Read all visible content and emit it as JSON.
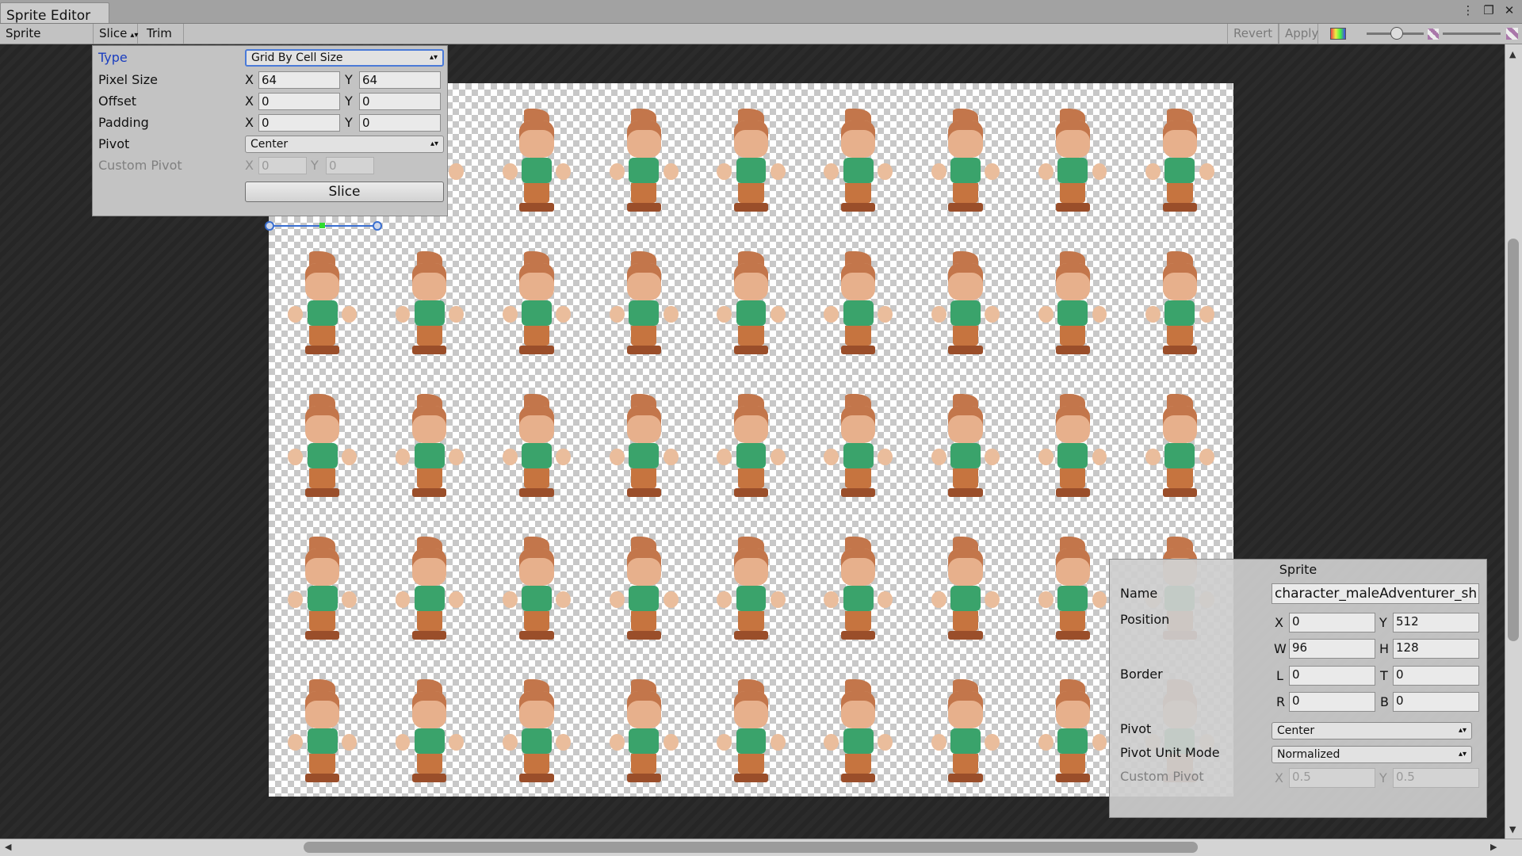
{
  "window": {
    "title": "Sprite Editor"
  },
  "toolbar": {
    "mode_label": "Sprite Editor",
    "slice_label": "Slice",
    "trim_label": "Trim",
    "revert_label": "Revert",
    "apply_label": "Apply",
    "zoom_level": 0.58
  },
  "slice_panel": {
    "type_label": "Type",
    "type_value": "Grid By Cell Size",
    "pixel_size_label": "Pixel Size",
    "pixel_size": {
      "x": "64",
      "y": "64"
    },
    "offset_label": "Offset",
    "offset": {
      "x": "0",
      "y": "0"
    },
    "padding_label": "Padding",
    "padding": {
      "x": "0",
      "y": "0"
    },
    "pivot_label": "Pivot",
    "pivot_value": "Center",
    "custom_pivot_label": "Custom Pivot",
    "custom_pivot": {
      "x": "0",
      "y": "0"
    },
    "slice_button": "Slice",
    "axis_x": "X",
    "axis_y": "Y"
  },
  "sprite_panel": {
    "title": "Sprite",
    "name_label": "Name",
    "name_value": "character_maleAdventurer_sh",
    "position_label": "Position",
    "position": {
      "x": "0",
      "y": "512",
      "w": "96",
      "h": "128"
    },
    "border_label": "Border",
    "border": {
      "l": "0",
      "t": "0",
      "r": "0",
      "b": "0"
    },
    "pivot_label": "Pivot",
    "pivot_value": "Center",
    "pivot_unit_label": "Pivot Unit Mode",
    "pivot_unit_value": "Normalized",
    "custom_pivot_label": "Custom Pivot",
    "custom_pivot": {
      "x": "0.5",
      "y": "0.5"
    },
    "axes": {
      "x": "X",
      "y": "Y",
      "w": "W",
      "h": "H",
      "l": "L",
      "t": "T",
      "r": "R",
      "b": "B"
    }
  },
  "sprite_sheet": {
    "columns": 9,
    "rows": 5
  }
}
